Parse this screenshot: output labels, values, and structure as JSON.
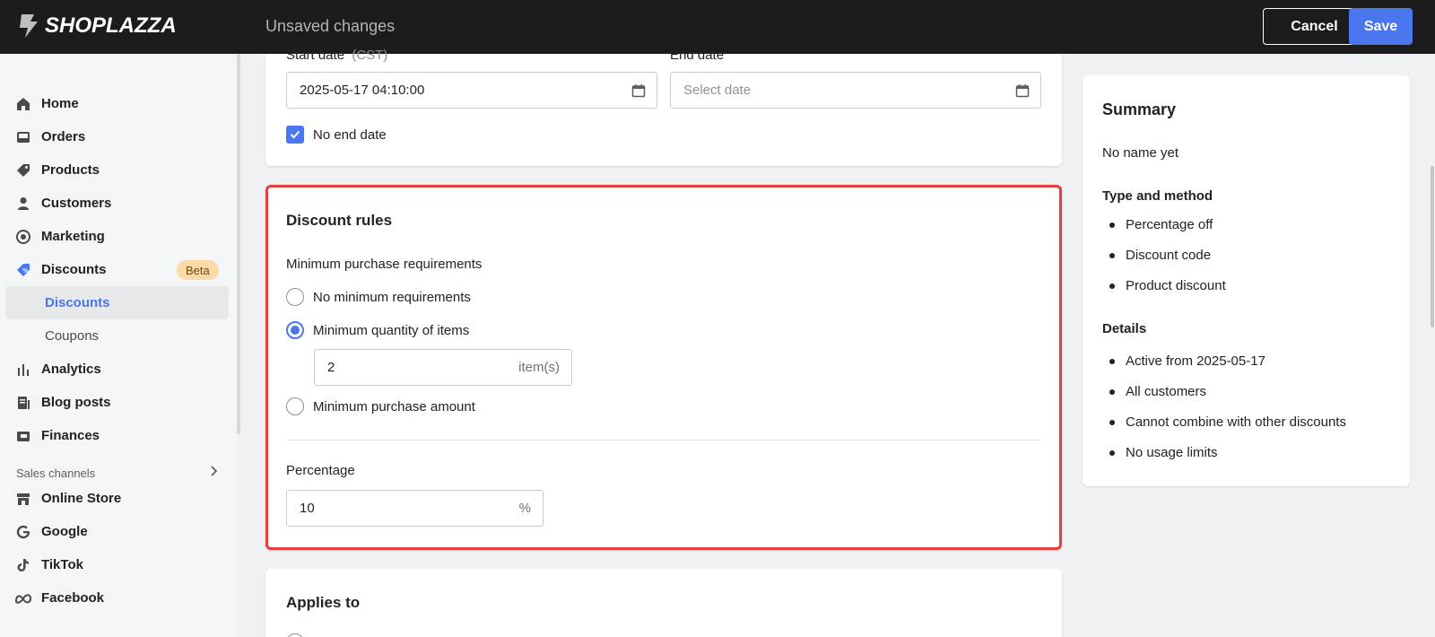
{
  "topbar": {
    "brand": "SHOPLAZZA",
    "status": "Unsaved changes",
    "cancel_label": "Cancel",
    "save_label": "Save",
    "save_color": "#4a76ee"
  },
  "sidebar": {
    "items": [
      {
        "label": "Home",
        "icon": "home-icon"
      },
      {
        "label": "Orders",
        "icon": "inbox-icon"
      },
      {
        "label": "Products",
        "icon": "tag-icon"
      },
      {
        "label": "Customers",
        "icon": "person-icon"
      },
      {
        "label": "Marketing",
        "icon": "target-icon"
      },
      {
        "label": "Discounts",
        "icon": "discount-tag-icon",
        "badge": "Beta"
      },
      {
        "label": "Analytics",
        "icon": "bar-chart-icon"
      },
      {
        "label": "Blog posts",
        "icon": "document-icon"
      },
      {
        "label": "Finances",
        "icon": "wallet-icon"
      }
    ],
    "sub_items": [
      "Discounts",
      "Coupons"
    ],
    "sales_channels_label": "Sales channels",
    "channels": [
      {
        "label": "Online Store",
        "icon": "store-icon"
      },
      {
        "label": "Google",
        "icon": "google-icon"
      },
      {
        "label": "TikTok",
        "icon": "tiktok-icon"
      },
      {
        "label": "Facebook",
        "icon": "meta-icon"
      }
    ]
  },
  "dates": {
    "start_label": "Start date",
    "start_tz": "(CST)",
    "start_value": "2025-05-17 04:10:00",
    "end_label": "End date",
    "end_placeholder": "Select date",
    "no_end_label": "No end date",
    "no_end_checked": true
  },
  "rules": {
    "title": "Discount rules",
    "min_req_label": "Minimum purchase requirements",
    "options": [
      {
        "label": "No minimum requirements",
        "selected": false
      },
      {
        "label": "Minimum quantity of items",
        "selected": true
      },
      {
        "label": "Minimum purchase amount",
        "selected": false
      }
    ],
    "quantity_value": "2",
    "quantity_suffix": "item(s)",
    "percentage_label": "Percentage",
    "percentage_value": "10",
    "percentage_suffix": "%",
    "highlight_color": "#e53e3e"
  },
  "applies": {
    "title": "Applies to"
  },
  "summary": {
    "title": "Summary",
    "name": "No name yet",
    "type_heading": "Type and method",
    "type_items": [
      "Percentage off",
      "Discount code",
      "Product discount"
    ],
    "details_heading": "Details",
    "details_items": [
      "Active from 2025-05-17",
      "All customers",
      "Cannot combine with other discounts",
      "No usage limits"
    ]
  }
}
